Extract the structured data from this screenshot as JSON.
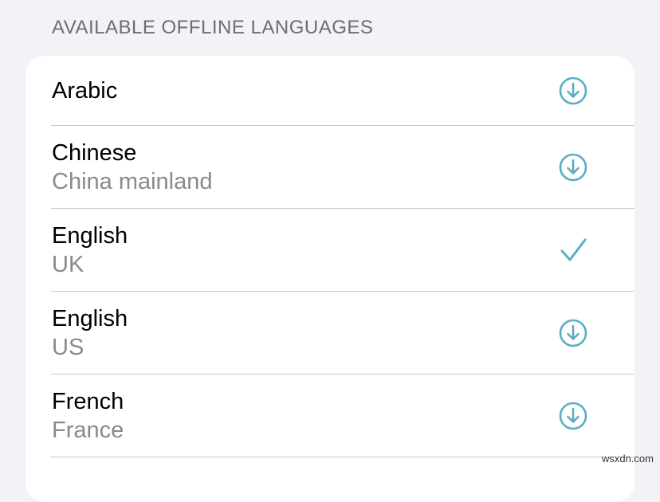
{
  "section": {
    "header": "AVAILABLE OFFLINE LANGUAGES"
  },
  "languages": [
    {
      "title": "Arabic",
      "subtitle": "",
      "status_icon": "download-icon"
    },
    {
      "title": "Chinese",
      "subtitle": "China mainland",
      "status_icon": "download-icon"
    },
    {
      "title": "English",
      "subtitle": "UK",
      "status_icon": "checkmark-icon"
    },
    {
      "title": "English",
      "subtitle": "US",
      "status_icon": "download-icon"
    },
    {
      "title": "French",
      "subtitle": "France",
      "status_icon": "download-icon"
    }
  ],
  "watermark": "wsxdn.com",
  "colors": {
    "accent": "#5aaec3",
    "background": "#f2f2f7",
    "card": "#ffffff",
    "secondary_text": "#8a8a8e",
    "header_text": "#6d6d72"
  }
}
